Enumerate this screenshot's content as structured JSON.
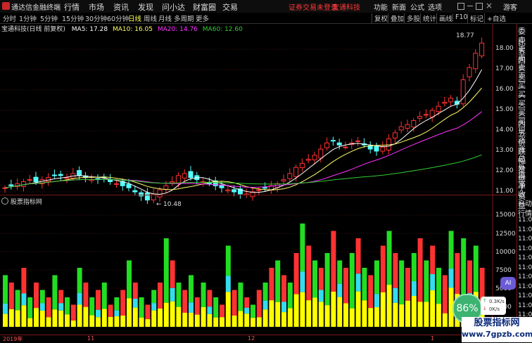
{
  "titlebar": {
    "app_name": "通达信金融终端",
    "menus": [
      "行情",
      "市场",
      "资讯",
      "发现",
      "问小达",
      "财富圈",
      "交易"
    ],
    "warning": "证券交易未登录",
    "stock_tag": "宝通科技",
    "right_menus": [
      "功能",
      "新面",
      "公式",
      "选项"
    ],
    "user": "游客"
  },
  "toolbar": {
    "periods": [
      "分时",
      "1分钟",
      "5分钟",
      "15分钟",
      "30分钟",
      "60分钟",
      "日线",
      "周线",
      "月线",
      "多周期",
      "更多"
    ],
    "active_period": "日线",
    "right_buttons": [
      "复权",
      "叠加",
      "多股",
      "统计",
      "画线",
      "F10",
      "标记",
      "+自选"
    ]
  },
  "infobar": {
    "name": "宝通科技(日线 前复权)",
    "ma5": "MA5: 17.28",
    "ma10": "MA10: 16.05",
    "ma20": "MA20: 14.76",
    "ma60": "MA60: 12.60"
  },
  "price_axis": [
    "18.00",
    "17.00",
    "16.00",
    "15.00",
    "14.00",
    "13.00",
    "12.00",
    "11.00"
  ],
  "annotations": {
    "high": "18.77",
    "low": "10.48"
  },
  "volume_panel": {
    "title": "股票指标网",
    "axis": [
      "15000",
      "12500",
      "10000",
      "7500",
      "5000",
      "2500"
    ]
  },
  "right_panel": {
    "top_items": [
      "委比",
      "卖五",
      "卖四",
      "卖三",
      "卖二",
      "卖一",
      "买一",
      "买二",
      "买三",
      "买四",
      "买五",
      "现价",
      "涨跌",
      "涨幅",
      "总量",
      "外盘",
      "换手",
      "净资",
      "收益"
    ],
    "bottom_items": [
      "自动",
      "行情",
      "11:01",
      "11:01",
      "11:02",
      "11:02",
      "11:02",
      "11:02",
      "11:02",
      "11:02",
      "11:02",
      "11:02",
      "11:02",
      "11:02"
    ]
  },
  "date_axis": [
    "2019年",
    "11",
    "12",
    "1"
  ],
  "overlay": {
    "percent": "86%",
    "up_speed": "0.3K/s",
    "down_speed": "0K/s",
    "ai_label": "AI",
    "watermark_title": "股票指标网",
    "watermark_url": "www.7gpzb.com"
  },
  "colors": {
    "up": "#ff3232",
    "down": "#54ffff",
    "ma5": "#ffffff",
    "ma10": "#ffff66",
    "ma20": "#ff33ff",
    "ma60": "#33cc33",
    "vol_green": "#22dd22",
    "vol_yellow": "#ffff00",
    "vol_cyan": "#33ddee"
  }
}
